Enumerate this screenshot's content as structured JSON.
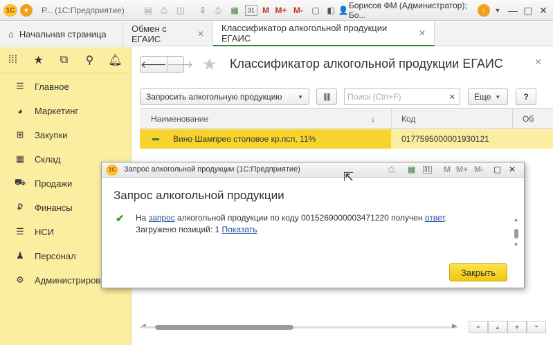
{
  "app": {
    "title": "Р... (1С:Предприятие)",
    "user": "Борисов ФМ (Администратор); Бо..."
  },
  "titlebar": {
    "m_label": "M",
    "mplus_label": "M+",
    "mminus_label": "M-",
    "calendar_day": "31"
  },
  "tabs": [
    {
      "label": "Начальная страница",
      "active": false
    },
    {
      "label": "Обмен с ЕГАИС",
      "active": false
    },
    {
      "label": "Классификатор алкогольной продукции ЕГАИС",
      "active": true
    }
  ],
  "sidebar": {
    "items": [
      {
        "label": "Главное",
        "icon": "menu-icon"
      },
      {
        "label": "Маркетинг",
        "icon": "pie-chart-icon"
      },
      {
        "label": "Закупки",
        "icon": "cart-icon"
      },
      {
        "label": "Склад",
        "icon": "warehouse-icon"
      },
      {
        "label": "Продажи",
        "icon": "sales-cart-icon"
      },
      {
        "label": "Финансы",
        "icon": "ruble-icon"
      },
      {
        "label": "НСИ",
        "icon": "nsi-icon"
      },
      {
        "label": "Персонал",
        "icon": "person-icon"
      },
      {
        "label": "Администрирова",
        "icon": "gear-icon"
      }
    ]
  },
  "form": {
    "title": "Классификатор алкогольной продукции ЕГАИС",
    "request_button": "Запросить алкогольную продукцию",
    "search_placeholder": "Поиск (Ctrl+F)",
    "more_button": "Еще",
    "help_button": "?",
    "columns": [
      "Наименование",
      "Код",
      "Об"
    ],
    "rows": [
      {
        "name": "Вино Шампрео столовое кр.псл, 11%",
        "code": "0177595000001930121"
      }
    ]
  },
  "dialog": {
    "window_title": "Запрос алкогольной продукции  (1С:Предприятие)",
    "heading": "Запрос алкогольной продукции",
    "msg_prefix": "На ",
    "msg_link1": "запрос",
    "msg_mid": " алкогольной продукции по коду 0015269000003471220 получен ",
    "msg_link2": "ответ",
    "msg_suffix": ".",
    "loaded_prefix": "Загружено позиций: 1 ",
    "loaded_link": "Показать",
    "close_button": "Закрыть",
    "m_label": "M",
    "mplus_label": "M+",
    "mminus_label": "M-",
    "calendar_day": "31"
  },
  "colors": {
    "sidebar_bg": "#fbeea0",
    "selected_row": "#f6d32d",
    "accent_green": "#2b8a3e",
    "link": "#1f4f9e"
  }
}
